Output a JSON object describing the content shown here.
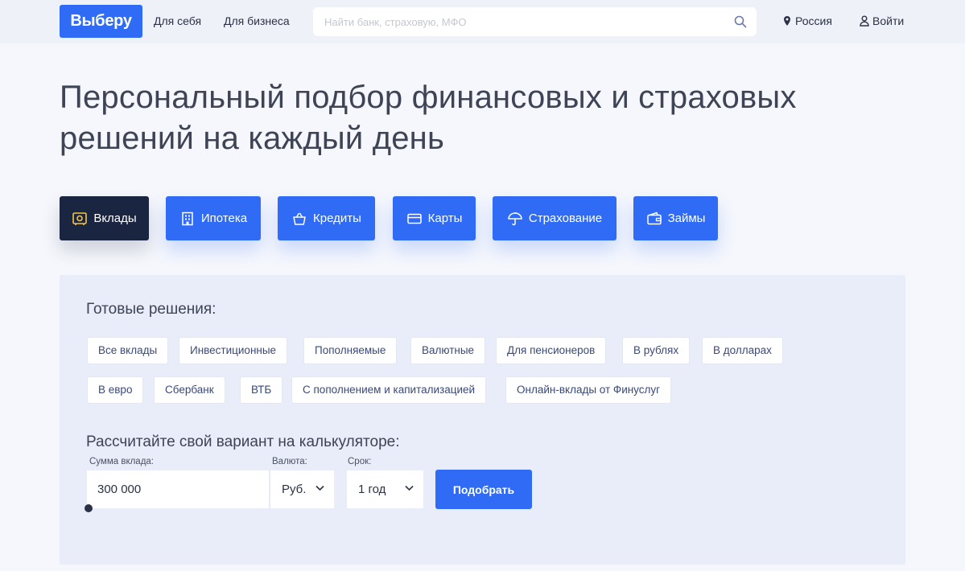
{
  "header": {
    "logo": "Выберу",
    "nav": [
      "Для себя",
      "Для бизнеса"
    ],
    "search_placeholder": "Найти банк, страховую, МФО",
    "region": "Россия",
    "login": "Войти"
  },
  "hero": {
    "line1": "Персональный подбор финансовых и страховых",
    "line2": "решений на каждый день"
  },
  "categories": [
    {
      "label": "Вклады",
      "icon": "safe-icon",
      "active": true
    },
    {
      "label": "Ипотека",
      "icon": "building-icon"
    },
    {
      "label": "Кредиты",
      "icon": "basket-icon"
    },
    {
      "label": "Карты",
      "icon": "card-icon"
    },
    {
      "label": "Страхование",
      "icon": "umbrella-icon"
    },
    {
      "label": "Займы",
      "icon": "wallet-icon"
    }
  ],
  "ready": {
    "title": "Готовые решения:",
    "chips": [
      "Все вклады",
      "Инвестиционные",
      "Пополняемые",
      "Валютные",
      "Для пенсионеров",
      "В рублях",
      "В долларах",
      "В евро",
      "Сбербанк",
      "ВТБ",
      "С пополнением и капитализацией",
      "Онлайн-вклады от Финуслуг"
    ]
  },
  "calculator": {
    "title": "Рассчитайте свой вариант на калькуляторе:",
    "amount_label": "Сумма вклада:",
    "amount_value": "300 000",
    "currency_label": "Валюта:",
    "currency_value": "Руб.",
    "term_label": "Срок:",
    "term_value": "1 год",
    "submit": "Подобрать"
  },
  "colors": {
    "accent": "#2f6bf5",
    "active_category": "#1a2541",
    "panel_bg": "#e9edf9"
  }
}
